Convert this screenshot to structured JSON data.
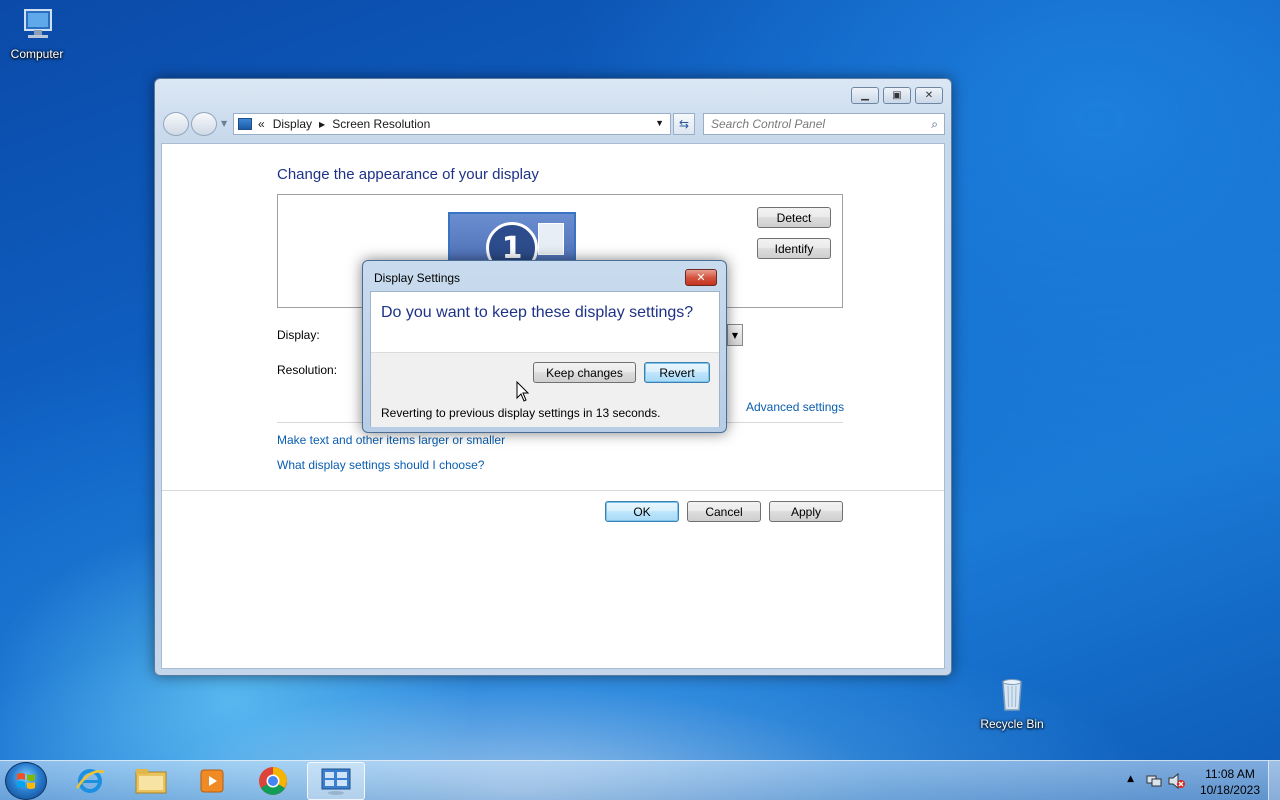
{
  "desktop": {
    "icons": [
      {
        "label": "Computer",
        "icon": "computer-icon"
      },
      {
        "label": "Recycle Bin",
        "icon": "recycle-bin-icon"
      }
    ]
  },
  "window": {
    "controls": [
      "minimize",
      "maximize",
      "close"
    ],
    "address": {
      "chevron": "«",
      "crumbs": [
        "Display",
        "Screen Resolution"
      ]
    },
    "search_placeholder": "Search Control Panel",
    "heading": "Change the appearance of your display",
    "monitor_number": "1",
    "detect_label": "Detect",
    "identify_label": "Identify",
    "display_label": "Display:",
    "resolution_label": "Resolution:",
    "advanced_link": "Advanced settings",
    "links": [
      "Make text and other items larger or smaller",
      "What display settings should I choose?"
    ],
    "ok_label": "OK",
    "cancel_label": "Cancel",
    "apply_label": "Apply"
  },
  "dialog": {
    "title": "Display Settings",
    "question": "Do you want to keep these display settings?",
    "keep_label": "Keep changes",
    "revert_label": "Revert",
    "message": "Reverting to previous display settings in 13 seconds."
  },
  "taskbar": {
    "apps": [
      "Internet Explorer",
      "Windows Explorer",
      "Windows Media Player",
      "Google Chrome",
      "Control Panel"
    ],
    "active_app": "Control Panel",
    "clock_time": "11:08 AM",
    "clock_date": "10/18/2023"
  },
  "colors": {
    "heading": "#1e3287",
    "link": "#0a5eb0",
    "default_button": "#3c7fb1"
  }
}
